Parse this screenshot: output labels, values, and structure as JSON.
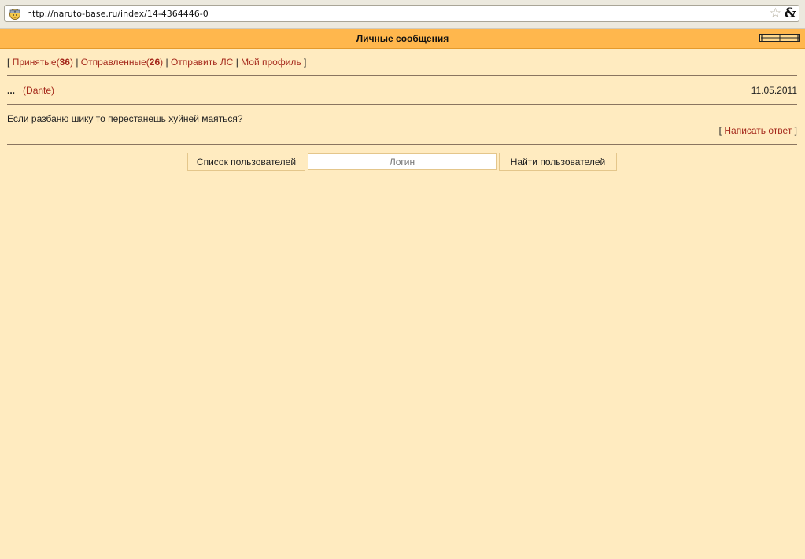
{
  "browser": {
    "url": "http://naruto-base.ru/index/14-4364446-0",
    "favicon": "naruto-favicon-icon",
    "bookmark_icon": "☆",
    "extra_icon": "&"
  },
  "header": {
    "title": "Личные сообщения",
    "background": "#FFB74D"
  },
  "nav": {
    "open_bracket": "[",
    "received_label": "Принятые",
    "received_count_open": "(",
    "received_count": "36",
    "received_count_close": ")",
    "sep1": "|",
    "sent_label": "Отправленные",
    "sent_count_open": "(",
    "sent_count": "26",
    "sent_count_close": ")",
    "sep2": "|",
    "send_pm": "Отправить ЛС",
    "sep3": "|",
    "profile": "Мой профиль",
    "close_bracket": "]"
  },
  "message": {
    "subject": "...",
    "author": "(Dante)",
    "date": "11.05.2011",
    "body": "Если разбаню шику то перестанешь хуйней маяться?",
    "reply_open": "[",
    "reply_label": "Написать ответ",
    "reply_close": "]"
  },
  "user_search": {
    "list_button": "Список пользователей",
    "login_placeholder": "Логин",
    "find_button": "Найти пользователей"
  },
  "colors": {
    "page_background": "#FFEBC0",
    "link": "#A5291C",
    "header": "#FFB74D"
  }
}
